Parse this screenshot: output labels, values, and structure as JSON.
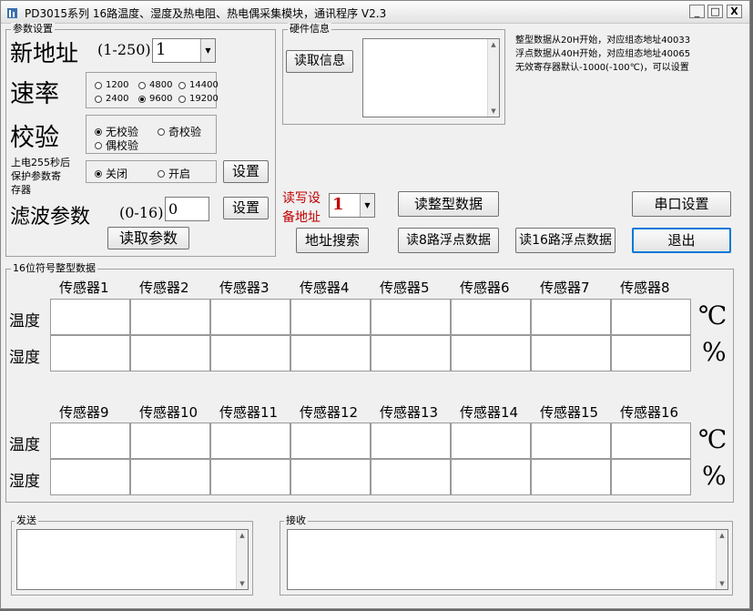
{
  "window": {
    "title": "PD3015系列 16路温度、湿度及热电阻、热电偶采集模块，通讯程序 V2.3",
    "min": "_",
    "max": "□",
    "close": "X"
  },
  "params": {
    "group_title": "参数设置",
    "new_addr_label": "新地址",
    "new_addr_range": "(1-250)",
    "new_addr_value": "1",
    "baud_label": "速率",
    "baud_options": [
      "1200",
      "4800",
      "14400",
      "2400",
      "9600",
      "19200"
    ],
    "baud_selected": "9600",
    "check_label": "校验",
    "check_options": [
      "无校验",
      "奇校验",
      "偶校验"
    ],
    "check_selected": "无校验",
    "protect_label_1": "上电255秒后",
    "protect_label_2": "保护参数寄",
    "protect_label_3": "存器",
    "protect_options": [
      "关闭",
      "开启"
    ],
    "protect_selected": "关闭",
    "set_button": "设置",
    "filter_label": "滤波参数",
    "filter_range": "(0-16)",
    "filter_value": "0",
    "filter_set_button": "设置",
    "read_params_button": "读取参数"
  },
  "hardware": {
    "group_title": "硬件信息",
    "read_info_button": "读取信息",
    "info_text": ""
  },
  "notes": {
    "line1": "整型数据从20H开始，对应组态地址40033",
    "line2": "浮点数据从40H开始，对应组态地址40065",
    "line3": "无效寄存器默认-1000(-100℃)，可以设置"
  },
  "device": {
    "label_1": "读写设",
    "label_2": "备地址",
    "addr_value": "1",
    "read_int_button": "读整型数据",
    "serial_settings_button": "串口设置",
    "addr_search_button": "地址搜索",
    "read8_float_button": "读8路浮点数据",
    "read16_float_button": "读16路浮点数据",
    "exit_button": "退出"
  },
  "data_grid": {
    "group_title": "16位符号整型数据",
    "row_temp": "温度",
    "row_humid": "湿度",
    "unit_temp": "℃",
    "unit_humid": "%",
    "sensors_a": [
      "传感器1",
      "传感器2",
      "传感器3",
      "传感器4",
      "传感器5",
      "传感器6",
      "传感器7",
      "传感器8"
    ],
    "sensors_b": [
      "传感器9",
      "传感器10",
      "传感器11",
      "传感器12",
      "传感器13",
      "传感器14",
      "传感器15",
      "传感器16"
    ]
  },
  "send": {
    "group_title": "发送",
    "text": ""
  },
  "receive": {
    "group_title": "接收",
    "text": ""
  },
  "colors": {
    "device_label": "#c00000",
    "accent": "#0078d7"
  }
}
